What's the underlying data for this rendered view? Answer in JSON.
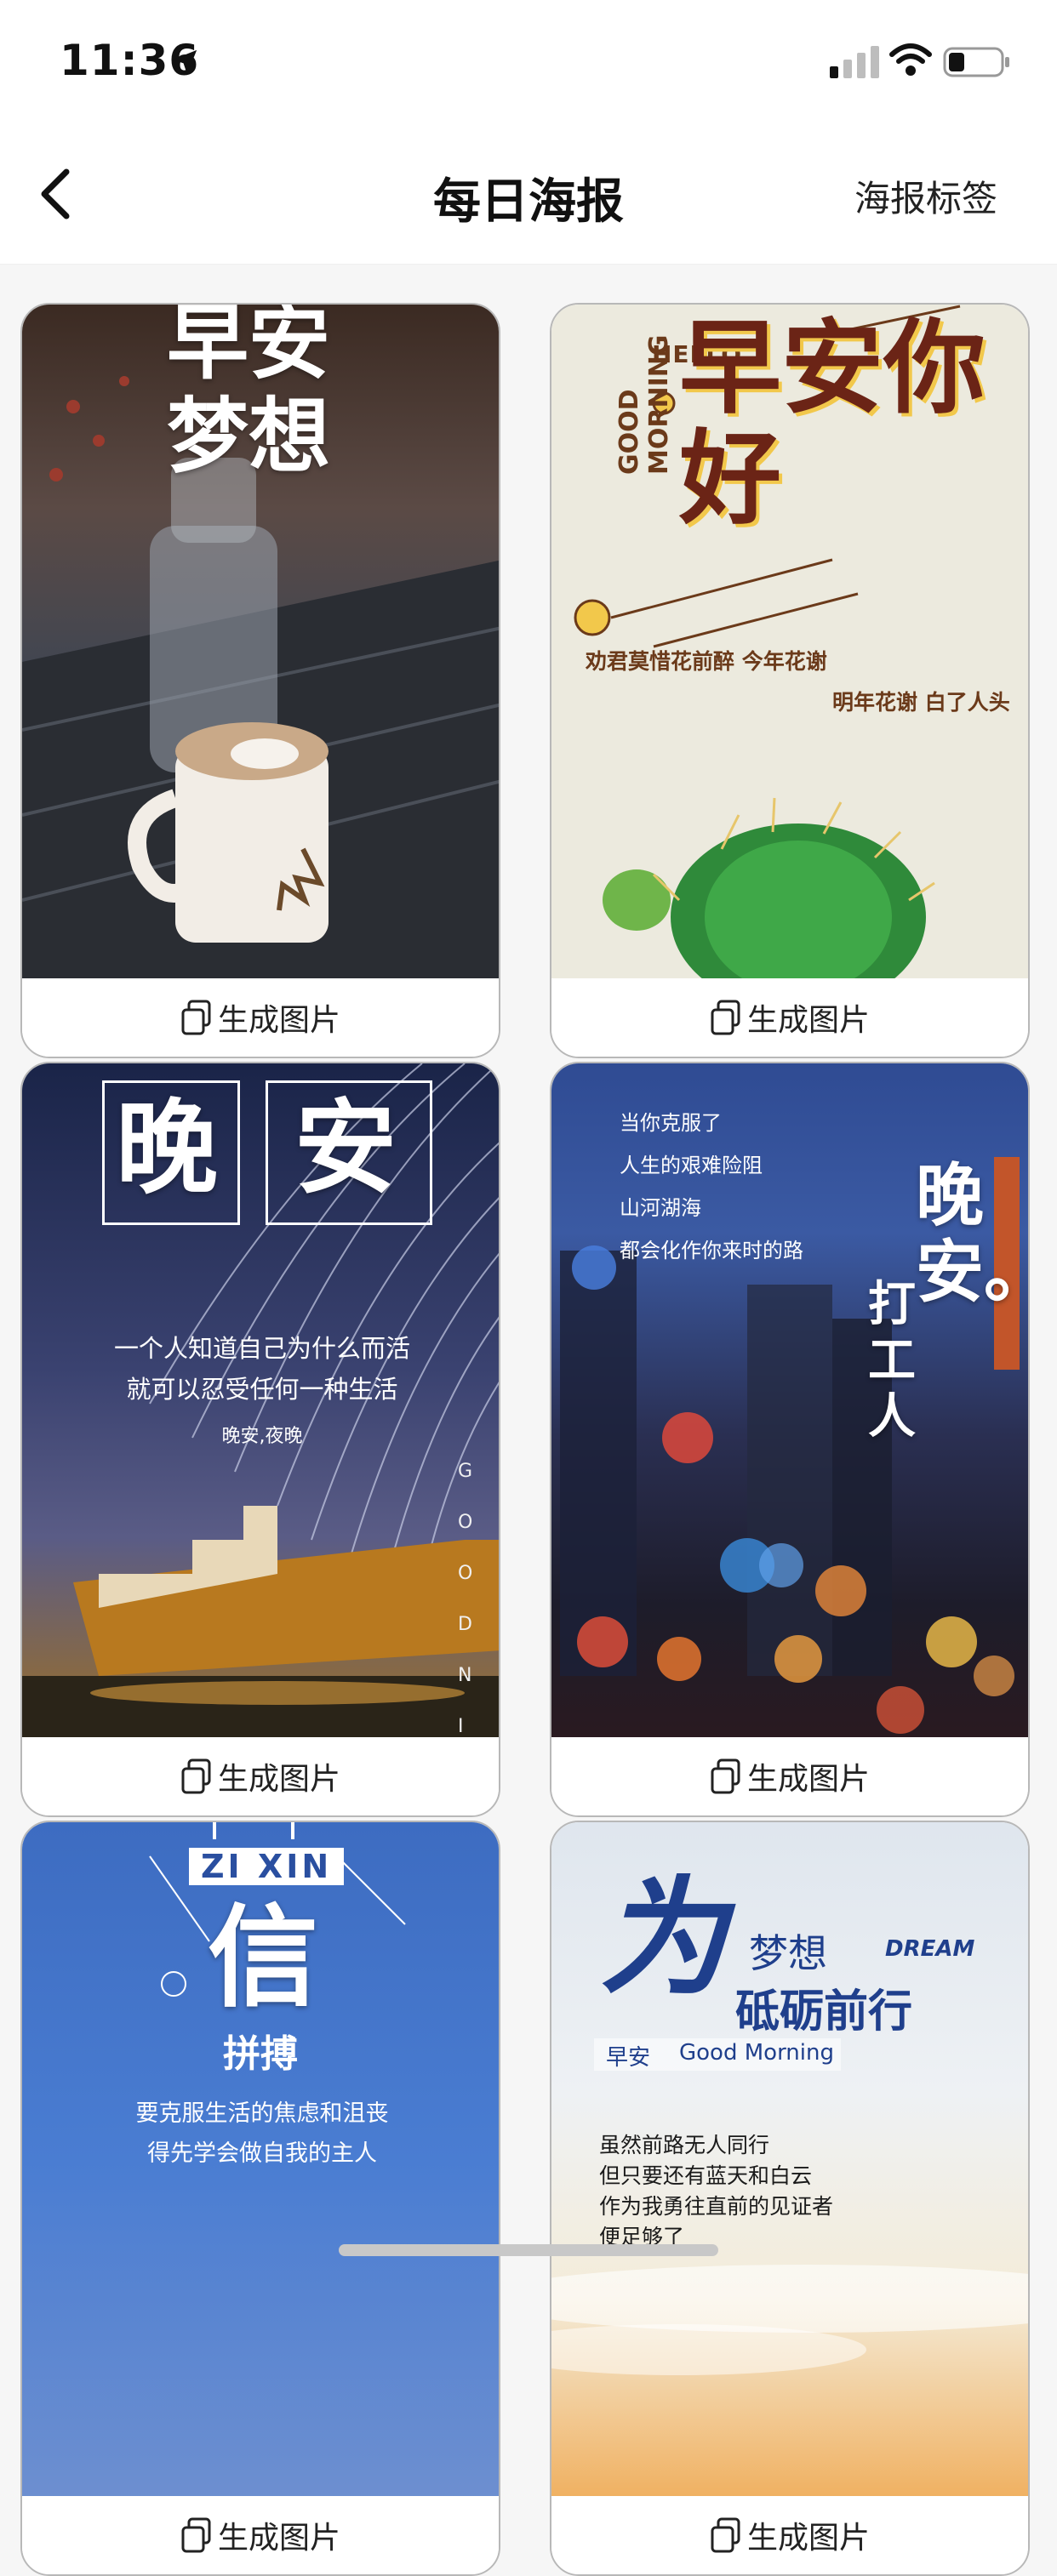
{
  "status": {
    "time": "11:36"
  },
  "nav": {
    "title": "每日海报",
    "right_label": "海报标签"
  },
  "cards": [
    {
      "action_label": "生成图片",
      "poster": {
        "lines": [
          "早安",
          "梦想"
        ]
      }
    },
    {
      "action_label": "生成图片",
      "poster": {
        "title": "早安你好",
        "english": [
          "HELLO",
          "GOOD MORNING"
        ],
        "line1": "劝君莫惜花前醉 今年花谢",
        "line2": "明年花谢 白了人头"
      }
    },
    {
      "action_label": "生成图片",
      "poster": {
        "chars": [
          "晚",
          "安"
        ],
        "line1": "一个人知道自己为什么而活",
        "line2": "就可以忍受任何一种生活",
        "line3": "晚安,夜晚",
        "vertical": "GOODNI"
      }
    },
    {
      "action_label": "生成图片",
      "poster": {
        "lines": [
          "当你克服了",
          "人生的艰难险阻",
          "山河湖海",
          "都会化作你来时的路"
        ],
        "big": "晚安。",
        "sub": "打工人"
      }
    },
    {
      "action_label": "生成图片",
      "poster": {
        "badge": "ZI XIN",
        "big": "信",
        "sub": "拼搏",
        "line1": "要克服生活的焦虑和沮丧",
        "line2": "得先学会做自我的主人"
      }
    },
    {
      "action_label": "生成图片",
      "poster": {
        "big": "为",
        "small": "梦想",
        "dream": "DREAM",
        "title": "砥砺前行",
        "tag": "早安",
        "tag_en": "Good Morning",
        "lines": [
          "虽然前路无人同行",
          "但只要还有蓝天和白云",
          "作为我勇往直前的见证者",
          "便足够了"
        ]
      }
    }
  ]
}
